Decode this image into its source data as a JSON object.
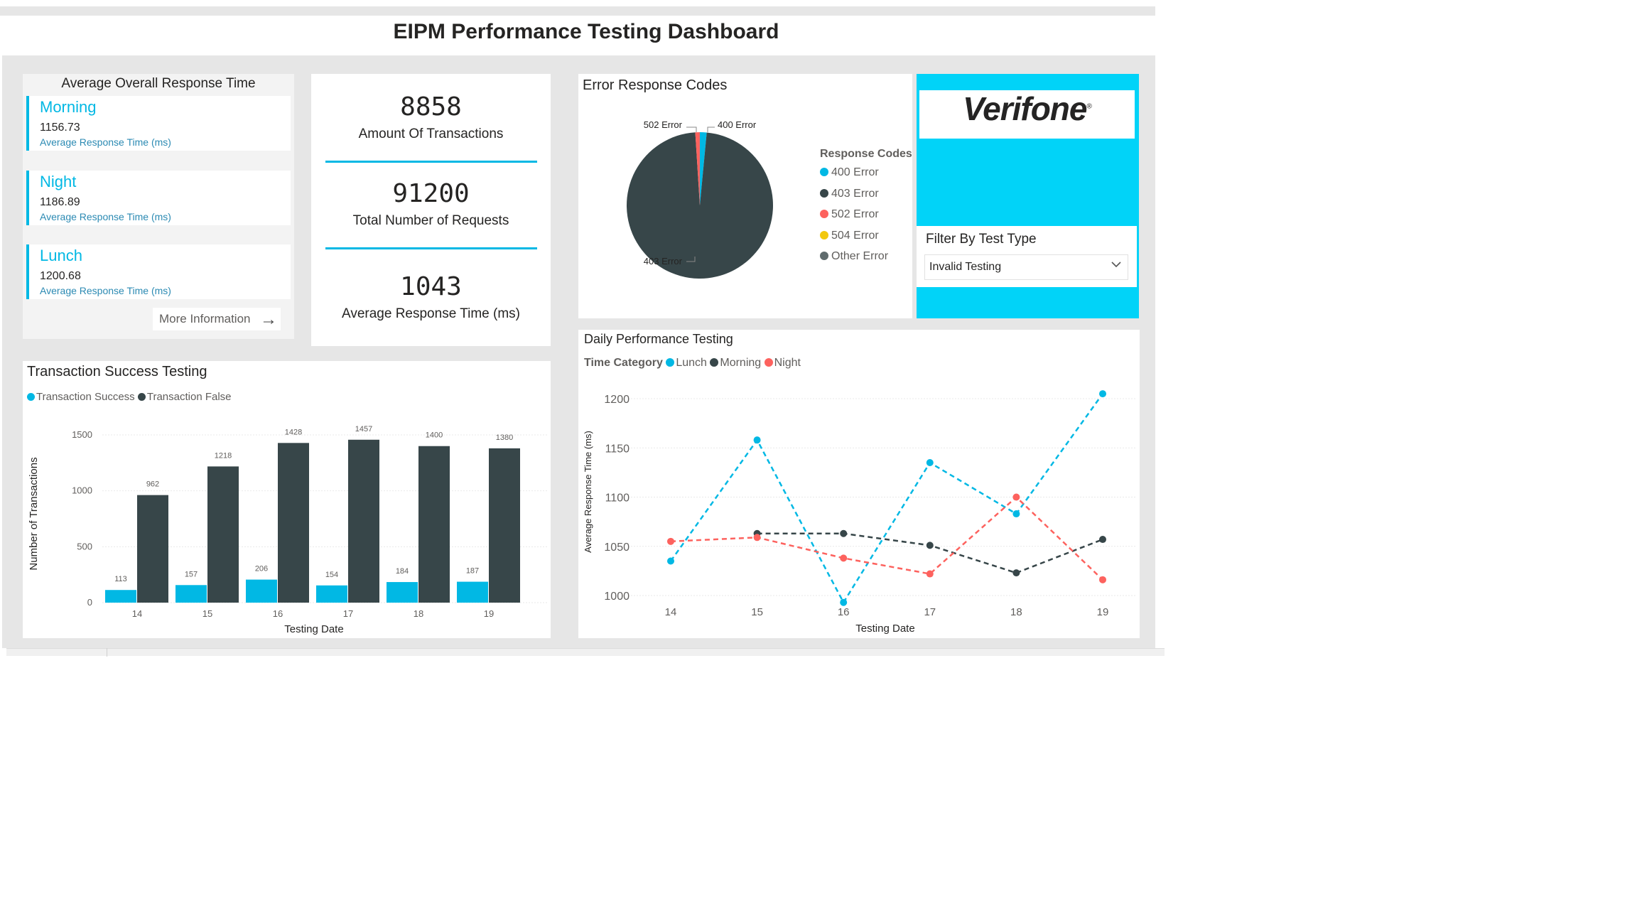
{
  "page": {
    "title": "EIPM Performance Testing Dashboard"
  },
  "avg_response": {
    "title": "Average Overall Response Time",
    "items": [
      {
        "name": "Morning",
        "value": "1156.73",
        "label": "Average Response Time (ms)"
      },
      {
        "name": "Night",
        "value": "1186.89",
        "label": "Average Response Time (ms)"
      },
      {
        "name": "Lunch",
        "value": "1200.68",
        "label": "Average Response Time (ms)"
      }
    ],
    "more_button": "More Information",
    "more_icon": "arrow-right-icon"
  },
  "kpis": [
    {
      "value": "8858",
      "caption": "Amount Of Transactions"
    },
    {
      "value": "91200",
      "caption": "Total Number of Requests"
    },
    {
      "value": "1043",
      "caption": "Average Response Time (ms)"
    }
  ],
  "error_card": {
    "title": "Error Response Codes",
    "legend_title": "Response Codes",
    "legend": [
      {
        "label": "400 Error",
        "color": "#01b8e4"
      },
      {
        "label": "403 Error",
        "color": "#374649"
      },
      {
        "label": "502 Error",
        "color": "#fd625e"
      },
      {
        "label": "504 Error",
        "color": "#f2c80f"
      },
      {
        "label": "Other Error",
        "color": "#5f6b6d"
      }
    ],
    "slice_labels": {
      "a": "502 Error",
      "b": "400 Error",
      "c": "403 Error"
    }
  },
  "logo": {
    "text": "Verifone",
    "mark": "®"
  },
  "filter": {
    "title": "Filter By Test Type",
    "value": "Invalid Testing",
    "icon": "chevron-down-icon"
  },
  "bar_card": {
    "title": "Transaction Success Testing",
    "legend": [
      {
        "label": "Transaction Success",
        "color": "#01b8e4"
      },
      {
        "label": "Transaction False",
        "color": "#374649"
      }
    ]
  },
  "line_card": {
    "title": "Daily Performance Testing",
    "legend_title": "Time Category",
    "legend": [
      {
        "label": "Lunch",
        "color": "#01b8e4"
      },
      {
        "label": "Morning",
        "color": "#374649"
      },
      {
        "label": "Night",
        "color": "#fd625e"
      }
    ]
  },
  "chart_data": [
    {
      "type": "pie",
      "title": "Error Response Codes",
      "labels": [
        "400 Error",
        "403 Error",
        "502 Error",
        "504 Error",
        "Other Error"
      ],
      "values": [
        1.5,
        97.5,
        1.0,
        0,
        0
      ],
      "colors": [
        "#01b8e4",
        "#374649",
        "#fd625e",
        "#f2c80f",
        "#5f6b6d"
      ]
    },
    {
      "type": "bar",
      "title": "Transaction Success Testing",
      "categories": [
        "14",
        "15",
        "16",
        "17",
        "18",
        "19"
      ],
      "series": [
        {
          "name": "Transaction Success",
          "values": [
            113,
            157,
            206,
            154,
            184,
            187
          ],
          "color": "#01b8e4"
        },
        {
          "name": "Transaction False",
          "values": [
            962,
            1218,
            1428,
            1457,
            1400,
            1380
          ],
          "color": "#374649"
        }
      ],
      "yticks": [
        0,
        500,
        1000,
        1500
      ],
      "ylim": [
        0,
        1500
      ],
      "xlabel": "Testing Date",
      "ylabel": "Number of Transactions"
    },
    {
      "type": "line",
      "title": "Daily Performance Testing",
      "categories": [
        "14",
        "15",
        "16",
        "17",
        "18",
        "19"
      ],
      "series": [
        {
          "name": "Lunch",
          "values": [
            1035,
            1158,
            993,
            1135,
            1083,
            1205
          ],
          "color": "#01b8e4"
        },
        {
          "name": "Morning",
          "values": [
            null,
            1063,
            1063,
            1051,
            1023,
            1057
          ],
          "color": "#374649"
        },
        {
          "name": "Night",
          "values": [
            1055,
            1059,
            1038,
            1022,
            1100,
            1016
          ],
          "color": "#fd625e"
        }
      ],
      "yticks": [
        1000,
        1050,
        1100,
        1150,
        1200
      ],
      "ylim": [
        995,
        1210
      ],
      "xlabel": "Testing Date",
      "ylabel": "Average Response Time (ms)"
    }
  ]
}
